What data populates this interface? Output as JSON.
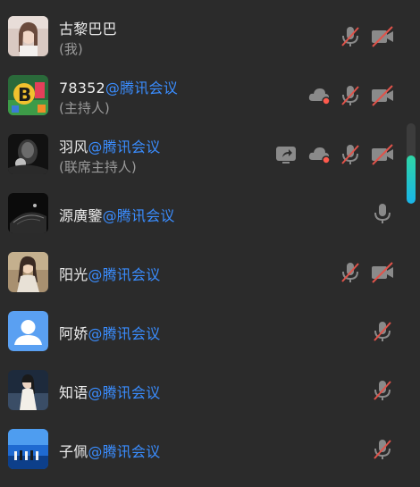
{
  "participants": [
    {
      "name": "古黎巴巴",
      "suffix": "",
      "role": "(我)"
    },
    {
      "name": "78352",
      "suffix": "@腾讯会议",
      "role": "(主持人)"
    },
    {
      "name": "羽风",
      "suffix": "@腾讯会议",
      "role": "(联席主持人)"
    },
    {
      "name": "源廣鑒",
      "suffix": "@腾讯会议",
      "role": ""
    },
    {
      "name": "阳光",
      "suffix": "@腾讯会议",
      "role": ""
    },
    {
      "name": "阿娇",
      "suffix": "@腾讯会议",
      "role": ""
    },
    {
      "name": "知语",
      "suffix": "@腾讯会议",
      "role": ""
    },
    {
      "name": "子佩",
      "suffix": "@腾讯会议",
      "role": ""
    }
  ],
  "icons": {
    "mic_muted": "mic-muted-icon",
    "mic_on": "mic-icon",
    "camera_off": "camera-off-icon",
    "cloud_recording": "cloud-recording-icon",
    "screen_share": "screen-share-icon"
  },
  "colors": {
    "background": "#2b2b2b",
    "name": "#ececec",
    "suffix": "#3a8dff",
    "role": "#9a9a9a",
    "muted_slash": "#e0534a",
    "icon_gray": "#8a8a8a",
    "recording_dot": "#ff5a4d",
    "scroll_thumb": "#19b4e8"
  },
  "scroll": {
    "position_fraction": 0.4
  }
}
